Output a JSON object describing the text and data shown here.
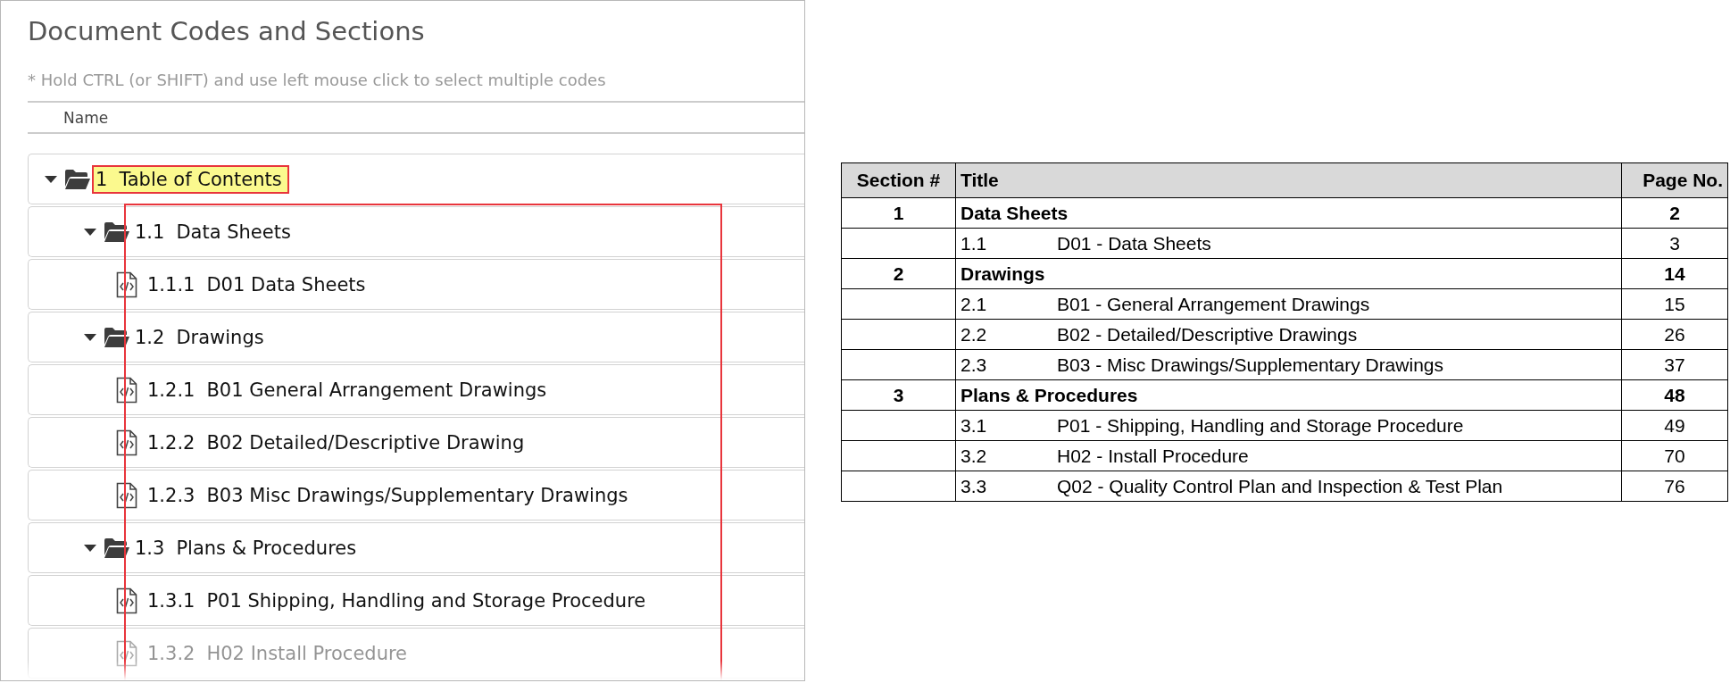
{
  "panel": {
    "title": "Document Codes and Sections",
    "hint": "* Hold CTRL (or SHIFT) and use left mouse click to select multiple codes",
    "column": "Name"
  },
  "tree": [
    {
      "kind": "folder",
      "number": "1",
      "label": "Table of Contents",
      "expanded": true,
      "selected": true,
      "children": [
        {
          "kind": "folder",
          "number": "1.1",
          "label": "Data Sheets",
          "expanded": true,
          "selected": false,
          "children": [
            {
              "kind": "file",
              "number": "1.1.1",
              "label": "D01 Data Sheets",
              "selected": false
            }
          ]
        },
        {
          "kind": "folder",
          "number": "1.2",
          "label": "Drawings",
          "expanded": true,
          "selected": false,
          "children": [
            {
              "kind": "file",
              "number": "1.2.1",
              "label": "B01 General Arrangement Drawings",
              "selected": false
            },
            {
              "kind": "file",
              "number": "1.2.2",
              "label": "B02 Detailed/Descriptive Drawing",
              "selected": false
            },
            {
              "kind": "file",
              "number": "1.2.3",
              "label": "B03 Misc Drawings/Supplementary Drawings",
              "selected": false
            }
          ]
        },
        {
          "kind": "folder",
          "number": "1.3",
          "label": "Plans & Procedures",
          "expanded": true,
          "selected": false,
          "children": [
            {
              "kind": "file",
              "number": "1.3.1",
              "label": "P01 Shipping, Handling and Storage Procedure",
              "selected": false
            },
            {
              "kind": "file",
              "number": "1.3.2",
              "label": "H02 Install Procedure",
              "selected": false
            }
          ]
        }
      ]
    }
  ],
  "table": {
    "columns": [
      "Section #",
      "Title",
      "Page No."
    ],
    "rows": [
      {
        "kind": "section",
        "section": "1",
        "title": "Data Sheets",
        "page": "2"
      },
      {
        "kind": "item",
        "number": "1.1",
        "title": "D01 - Data Sheets",
        "page": "3"
      },
      {
        "kind": "section",
        "section": "2",
        "title": "Drawings",
        "page": "14"
      },
      {
        "kind": "item",
        "number": "2.1",
        "title": "B01 - General Arrangement Drawings",
        "page": "15"
      },
      {
        "kind": "item",
        "number": "2.2",
        "title": "B02 - Detailed/Descriptive Drawings",
        "page": "26"
      },
      {
        "kind": "item",
        "number": "2.3",
        "title": "B03 - Misc Drawings/Supplementary Drawings",
        "page": "37"
      },
      {
        "kind": "section",
        "section": "3",
        "title": "Plans & Procedures",
        "page": "48"
      },
      {
        "kind": "item",
        "number": "3.1",
        "title": "P01 - Shipping, Handling and Storage Procedure",
        "page": "49"
      },
      {
        "kind": "item",
        "number": "3.2",
        "title": "H02 - Install Procedure",
        "page": "70"
      },
      {
        "kind": "item",
        "number": "3.3",
        "title": "Q02 - Quality Control Plan and Inspection & Test Plan",
        "page": "76"
      }
    ]
  }
}
